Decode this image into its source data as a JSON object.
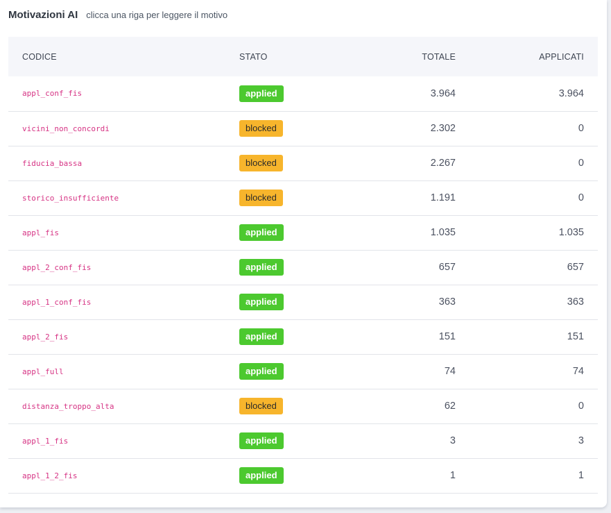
{
  "header": {
    "title": "Motivazioni AI",
    "subtitle": "clicca una riga per leggere il motivo"
  },
  "table": {
    "columns": {
      "code": "CODICE",
      "status": "STATO",
      "total": "TOTALE",
      "applied": "APPLICATI"
    },
    "rows": [
      {
        "code": "appl_conf_fis",
        "status": "applied",
        "total": "3.964",
        "applied": "3.964"
      },
      {
        "code": "vicini_non_concordi",
        "status": "blocked",
        "total": "2.302",
        "applied": "0"
      },
      {
        "code": "fiducia_bassa",
        "status": "blocked",
        "total": "2.267",
        "applied": "0"
      },
      {
        "code": "storico_insufficiente",
        "status": "blocked",
        "total": "1.191",
        "applied": "0"
      },
      {
        "code": "appl_fis",
        "status": "applied",
        "total": "1.035",
        "applied": "1.035"
      },
      {
        "code": "appl_2_conf_fis",
        "status": "applied",
        "total": "657",
        "applied": "657"
      },
      {
        "code": "appl_1_conf_fis",
        "status": "applied",
        "total": "363",
        "applied": "363"
      },
      {
        "code": "appl_2_fis",
        "status": "applied",
        "total": "151",
        "applied": "151"
      },
      {
        "code": "appl_full",
        "status": "applied",
        "total": "74",
        "applied": "74"
      },
      {
        "code": "distanza_troppo_alta",
        "status": "blocked",
        "total": "62",
        "applied": "0"
      },
      {
        "code": "appl_1_fis",
        "status": "applied",
        "total": "3",
        "applied": "3"
      },
      {
        "code": "appl_1_2_fis",
        "status": "applied",
        "total": "1",
        "applied": "1"
      }
    ]
  },
  "colors": {
    "applied": "#4cc92f",
    "blocked": "#f7b52c",
    "code_text": "#d63384"
  }
}
